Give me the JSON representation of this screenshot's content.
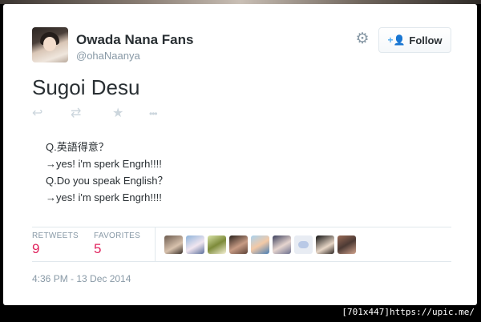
{
  "author": {
    "display_name": "Owada Nana Fans",
    "handle": "@ohaNaanya"
  },
  "follow_button": {
    "label": "Follow",
    "icon": "add-user-icon"
  },
  "settings_icon": "gear-icon",
  "tweet": {
    "title": "Sugoi Desu",
    "lines": [
      "Q.英語得意？",
      "→yes! i'm sperk Engrh!!!!",
      "Q.Do you speak English？",
      "→yes! i'm sperk Engrh!!!!"
    ],
    "actions": [
      {
        "name": "reply-icon",
        "glyph": "↩"
      },
      {
        "name": "retweet-icon",
        "glyph": "⇄"
      },
      {
        "name": "favorite-star-icon",
        "glyph": "★"
      },
      {
        "name": "more-icon",
        "glyph": "•••"
      }
    ]
  },
  "stats": {
    "retweets_label": "RETWEETS",
    "retweets_count": "9",
    "favorites_label": "FAVORITES",
    "favorites_count": "5"
  },
  "favoriter_avatar_count": 9,
  "timestamp": "4:36 PM - 13 Dec 2014",
  "image_credit": "[701x447]https://upic.me/",
  "colors": {
    "count_color": "#e0245e",
    "muted": "#8899a6",
    "accent": "#55acee"
  }
}
